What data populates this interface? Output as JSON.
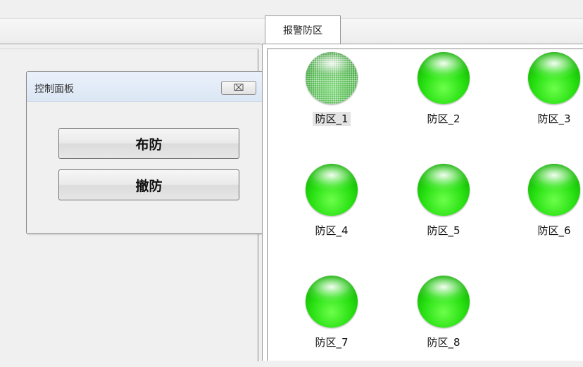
{
  "tabs": {
    "alarm_zones": "报警防区"
  },
  "control_panel": {
    "title": "控制面板",
    "close_label": "⌧",
    "arm_label": "布防",
    "disarm_label": "撤防"
  },
  "zones": [
    {
      "label": "防区_1",
      "selected": true
    },
    {
      "label": "防区_2",
      "selected": false
    },
    {
      "label": "防区_3",
      "selected": false
    },
    {
      "label": "防区_4",
      "selected": false
    },
    {
      "label": "防区_5",
      "selected": false
    },
    {
      "label": "防区_6",
      "selected": false
    },
    {
      "label": "防区_7",
      "selected": false
    },
    {
      "label": "防区_8",
      "selected": false
    }
  ],
  "colors": {
    "zone_light": "#22d40d",
    "panel_title_bg": "#dbe6f4"
  }
}
